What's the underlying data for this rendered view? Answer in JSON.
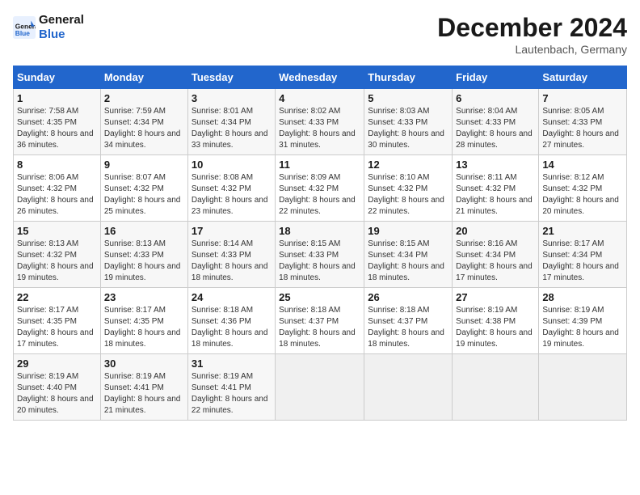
{
  "header": {
    "logo_text_general": "General",
    "logo_text_blue": "Blue",
    "month_title": "December 2024",
    "location": "Lautenbach, Germany"
  },
  "weekdays": [
    "Sunday",
    "Monday",
    "Tuesday",
    "Wednesday",
    "Thursday",
    "Friday",
    "Saturday"
  ],
  "weeks": [
    [
      {
        "day": "1",
        "sunrise": "7:58 AM",
        "sunset": "4:35 PM",
        "daylight": "8 hours and 36 minutes."
      },
      {
        "day": "2",
        "sunrise": "7:59 AM",
        "sunset": "4:34 PM",
        "daylight": "8 hours and 34 minutes."
      },
      {
        "day": "3",
        "sunrise": "8:01 AM",
        "sunset": "4:34 PM",
        "daylight": "8 hours and 33 minutes."
      },
      {
        "day": "4",
        "sunrise": "8:02 AM",
        "sunset": "4:33 PM",
        "daylight": "8 hours and 31 minutes."
      },
      {
        "day": "5",
        "sunrise": "8:03 AM",
        "sunset": "4:33 PM",
        "daylight": "8 hours and 30 minutes."
      },
      {
        "day": "6",
        "sunrise": "8:04 AM",
        "sunset": "4:33 PM",
        "daylight": "8 hours and 28 minutes."
      },
      {
        "day": "7",
        "sunrise": "8:05 AM",
        "sunset": "4:33 PM",
        "daylight": "8 hours and 27 minutes."
      }
    ],
    [
      {
        "day": "8",
        "sunrise": "8:06 AM",
        "sunset": "4:32 PM",
        "daylight": "8 hours and 26 minutes."
      },
      {
        "day": "9",
        "sunrise": "8:07 AM",
        "sunset": "4:32 PM",
        "daylight": "8 hours and 25 minutes."
      },
      {
        "day": "10",
        "sunrise": "8:08 AM",
        "sunset": "4:32 PM",
        "daylight": "8 hours and 23 minutes."
      },
      {
        "day": "11",
        "sunrise": "8:09 AM",
        "sunset": "4:32 PM",
        "daylight": "8 hours and 22 minutes."
      },
      {
        "day": "12",
        "sunrise": "8:10 AM",
        "sunset": "4:32 PM",
        "daylight": "8 hours and 22 minutes."
      },
      {
        "day": "13",
        "sunrise": "8:11 AM",
        "sunset": "4:32 PM",
        "daylight": "8 hours and 21 minutes."
      },
      {
        "day": "14",
        "sunrise": "8:12 AM",
        "sunset": "4:32 PM",
        "daylight": "8 hours and 20 minutes."
      }
    ],
    [
      {
        "day": "15",
        "sunrise": "8:13 AM",
        "sunset": "4:32 PM",
        "daylight": "8 hours and 19 minutes."
      },
      {
        "day": "16",
        "sunrise": "8:13 AM",
        "sunset": "4:33 PM",
        "daylight": "8 hours and 19 minutes."
      },
      {
        "day": "17",
        "sunrise": "8:14 AM",
        "sunset": "4:33 PM",
        "daylight": "8 hours and 18 minutes."
      },
      {
        "day": "18",
        "sunrise": "8:15 AM",
        "sunset": "4:33 PM",
        "daylight": "8 hours and 18 minutes."
      },
      {
        "day": "19",
        "sunrise": "8:15 AM",
        "sunset": "4:34 PM",
        "daylight": "8 hours and 18 minutes."
      },
      {
        "day": "20",
        "sunrise": "8:16 AM",
        "sunset": "4:34 PM",
        "daylight": "8 hours and 17 minutes."
      },
      {
        "day": "21",
        "sunrise": "8:17 AM",
        "sunset": "4:34 PM",
        "daylight": "8 hours and 17 minutes."
      }
    ],
    [
      {
        "day": "22",
        "sunrise": "8:17 AM",
        "sunset": "4:35 PM",
        "daylight": "8 hours and 17 minutes."
      },
      {
        "day": "23",
        "sunrise": "8:17 AM",
        "sunset": "4:35 PM",
        "daylight": "8 hours and 18 minutes."
      },
      {
        "day": "24",
        "sunrise": "8:18 AM",
        "sunset": "4:36 PM",
        "daylight": "8 hours and 18 minutes."
      },
      {
        "day": "25",
        "sunrise": "8:18 AM",
        "sunset": "4:37 PM",
        "daylight": "8 hours and 18 minutes."
      },
      {
        "day": "26",
        "sunrise": "8:18 AM",
        "sunset": "4:37 PM",
        "daylight": "8 hours and 18 minutes."
      },
      {
        "day": "27",
        "sunrise": "8:19 AM",
        "sunset": "4:38 PM",
        "daylight": "8 hours and 19 minutes."
      },
      {
        "day": "28",
        "sunrise": "8:19 AM",
        "sunset": "4:39 PM",
        "daylight": "8 hours and 19 minutes."
      }
    ],
    [
      {
        "day": "29",
        "sunrise": "8:19 AM",
        "sunset": "4:40 PM",
        "daylight": "8 hours and 20 minutes."
      },
      {
        "day": "30",
        "sunrise": "8:19 AM",
        "sunset": "4:41 PM",
        "daylight": "8 hours and 21 minutes."
      },
      {
        "day": "31",
        "sunrise": "8:19 AM",
        "sunset": "4:41 PM",
        "daylight": "8 hours and 22 minutes."
      },
      null,
      null,
      null,
      null
    ]
  ]
}
